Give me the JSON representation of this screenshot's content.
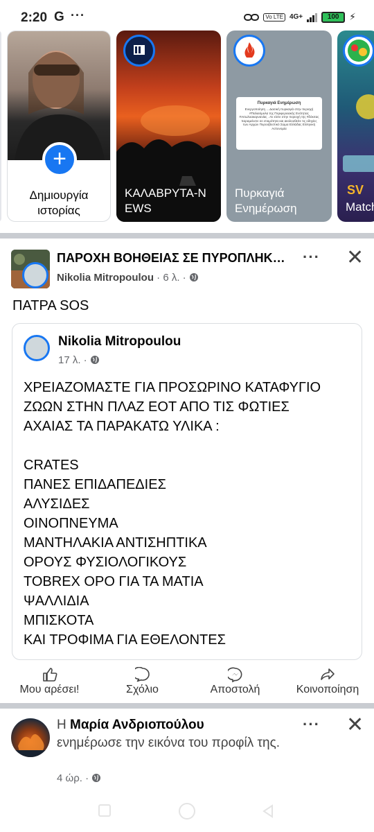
{
  "status_bar": {
    "time": "2:20",
    "app_icon": "G",
    "more": "···",
    "network": "4G+",
    "volte": "Vo LTE",
    "battery": "100"
  },
  "stories": [
    {
      "label_line1": "Δημιουργία",
      "label_line2": "ιστορίας",
      "icon": "plus-icon"
    },
    {
      "label_line1": "ΚΑΛΑΒΡΥΤΑ-Ν",
      "label_line2": "EWS"
    },
    {
      "label_line1": "Πυρκαγιά",
      "label_line2": "Ενημέρωση",
      "thumb_title": "Πυρκαγιά Ενημέρωση",
      "thumb_text": "Ενεργοποίηση ... Δασική πυρκαγιά στην περιοχή #Παλαιόμυλα της Περιφερειακής Ενότητας #Αιτωλοακαρνανίας . Αν είστε στην περιοχή της #δόκιτας παραμείνετε σε ετοιμότητα και ακολουθείτε τις οδηγίες των Αρχών Πυροσβεστικό Σώμα Ελλάδας Ελληνική Αστυνομία"
    },
    {
      "label_line1": "Match",
      "label_line2": ""
    }
  ],
  "post": {
    "group_title": "ΠΑΡΟΧΗ ΒΟΗΘΕΙΑΣ ΣΕ ΠΥΡΟΠΛΗΚΤΑ ΖΩΑ",
    "author": "Nikolia Mitropoulou",
    "time": "· 6 λ. ·",
    "text": "ΠΑΤΡΑ SOS",
    "shared": {
      "author": "Nikolia Mitropoulou",
      "time": "17 λ. ·",
      "lines": [
        "ΧΡΕΙΑΖΟΜΑΣΤΕ ΓΙΑ ΠΡΟΣΩΡΙΝΟ ΚΑΤΑΦΥΓΙΟ",
        "ΖΩΩΝ ΣΤΗΝ ΠΛΑΖ ΕΟΤ  ΑΠΟ ΤΙΣ ΦΩΤΙΕΣ",
        "ΑΧΑΙΑΣ  ΤΑ ΠΑΡΑΚΑΤΩ ΥΛΙΚΑ :",
        "",
        "CRATES",
        "ΠΑΝΕΣ ΕΠΙΔΑΠΕΔΙΕΣ",
        "ΑΛΥΣΙΔΕΣ",
        "ΟΙΝΟΠΝΕΥΜΑ",
        "ΜΑΝΤΗΛΑΚΙΑ ΑΝΤΙΣΗΠΤΙΚΑ",
        "ΟΡΟΥΣ ΦΥΣΙΟΛΟΓΙΚΟΥΣ",
        "TOBREX ΟΡΟ ΓΙΑ ΤΑ ΜΑΤΙΑ",
        "ΨΑΛΛΙΔΙΑ",
        "ΜΠΙΣΚΟΤΑ",
        "ΚΑΙ ΤΡΟΦΙΜΑ ΓΙΑ ΕΘΕΛΟΝΤΕΣ"
      ]
    },
    "actions": {
      "like": "Μου αρέσει!",
      "comment": "Σχόλιο",
      "send": "Αποστολή",
      "share": "Κοινοποίηση"
    }
  },
  "notification": {
    "prefix": "Η",
    "name": "Μαρία Ανδριοπούλου",
    "rest": "ενημέρωσε την εικόνα του προφίλ της.",
    "time": "4 ώρ. ·"
  },
  "colors": {
    "brand_blue": "#1877f2",
    "meta_gray": "#65676b",
    "divider": "#c9ccd1"
  }
}
